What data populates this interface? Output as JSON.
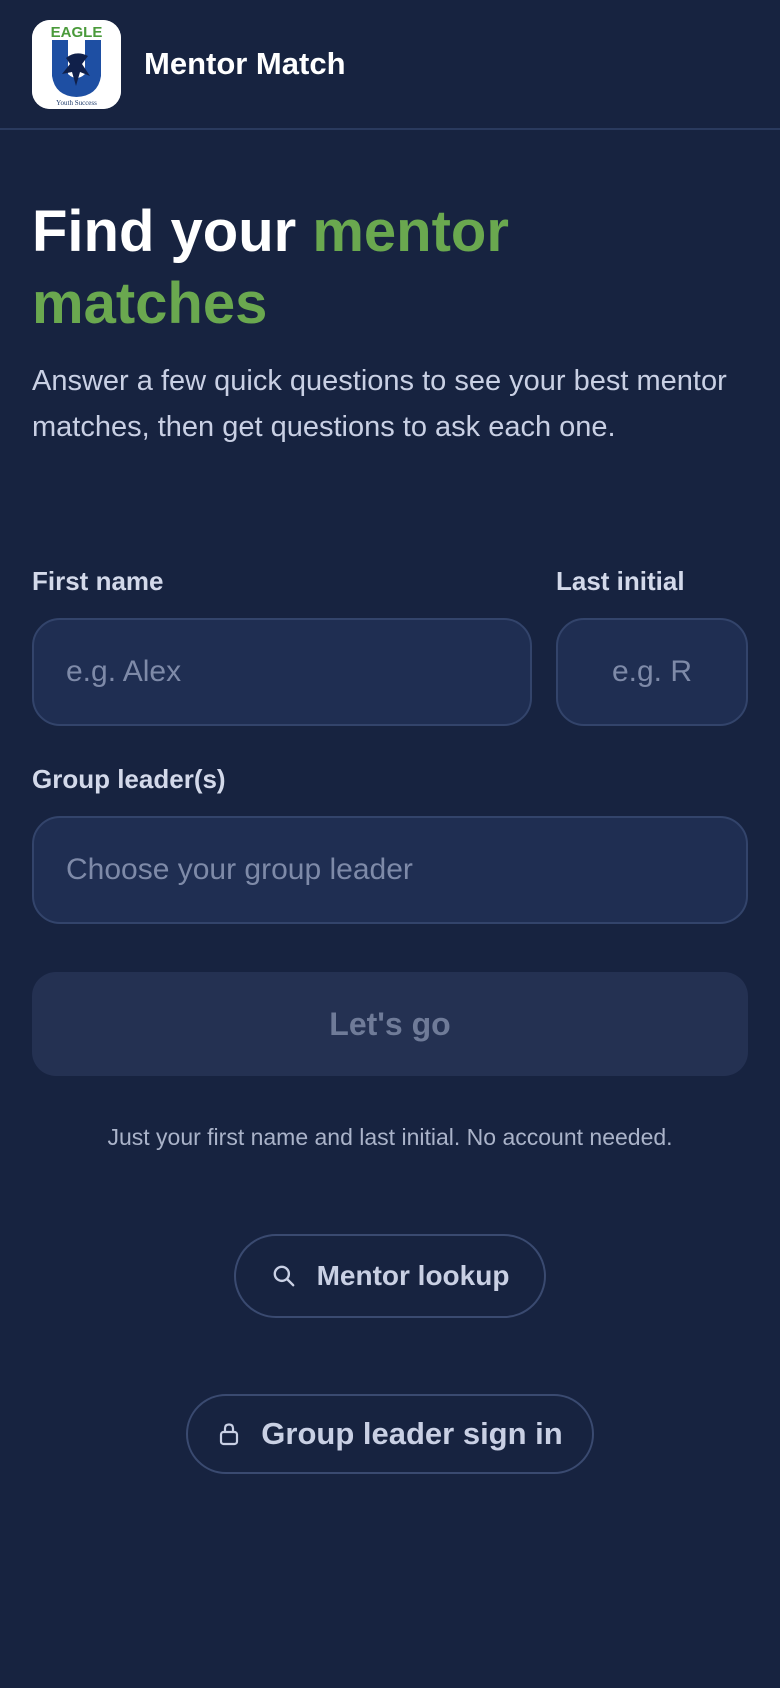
{
  "header": {
    "logo": {
      "top_text": "EAGLE",
      "bottom_text": "Youth Success",
      "colors": {
        "green": "#6aa84f",
        "blue": "#1e4fa3",
        "navy": "#10204a"
      }
    },
    "title": "Mentor Match"
  },
  "hero": {
    "title_part1": "Find your ",
    "title_accent": "mentor matches",
    "subtitle": "Answer a few quick questions to see your best mentor matches, then get questions to ask each one."
  },
  "form": {
    "first_name_label": "First name",
    "first_name_placeholder": "e.g. Alex",
    "first_name_value": "",
    "last_initial_label": "Last initial",
    "last_initial_placeholder": "e.g. R",
    "last_initial_value": "",
    "group_leader_label": "Group leader(s)",
    "group_leader_placeholder": "Choose your group leader",
    "submit_label": "Let's go",
    "note": "Just your first name and last initial. No account needed."
  },
  "links": {
    "lookup_label": "Mentor lookup",
    "lookup_icon": "search-icon",
    "signin_label": "Group leader sign in",
    "signin_icon": "lock-icon"
  },
  "colors": {
    "background": "#172340",
    "accent_green": "#6aa84f",
    "field_bg": "#1f2e52",
    "disabled_button": "#243152"
  }
}
